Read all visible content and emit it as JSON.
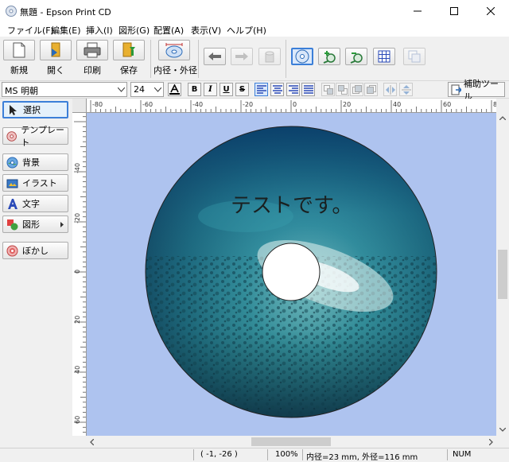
{
  "window": {
    "title": "無題 - Epson Print CD"
  },
  "menu": [
    "ファイル(F)",
    "編集(E)",
    "挿入(I)",
    "図形(G)",
    "配置(A)",
    "表示(V)",
    "ヘルプ(H)"
  ],
  "toolbar": {
    "new_label": "新規",
    "open_label": "開く",
    "print_label": "印刷",
    "save_label": "保存",
    "diameter_label": "内径・外径"
  },
  "format": {
    "font_name": "MS 明朝",
    "font_size": "24",
    "bold": "B",
    "italic": "I",
    "underline": "U",
    "strike": "S",
    "assist_label": "補助ツール"
  },
  "left_panel": {
    "select": "選択",
    "template": "テンプレート",
    "background": "背景",
    "illust": "イラスト",
    "text": "文字",
    "shape": "図形",
    "blur": "ぼかし"
  },
  "ruler": {
    "h_ticks": [
      "-80",
      "-60",
      "-40",
      "-20",
      "0",
      "20",
      "40",
      "60",
      "80"
    ],
    "v_ticks": [
      "-40",
      "-20",
      "0",
      "20",
      "40",
      "60"
    ]
  },
  "disc": {
    "text": "テストです。"
  },
  "status": {
    "coords": "(   -1, -26 )",
    "zoom": "100%",
    "diameter": "内径=23 mm, 外径=116 mm",
    "num": "NUM"
  },
  "colors": {
    "canvas_bg": "#aec3ef",
    "accent": "#0078d7"
  }
}
